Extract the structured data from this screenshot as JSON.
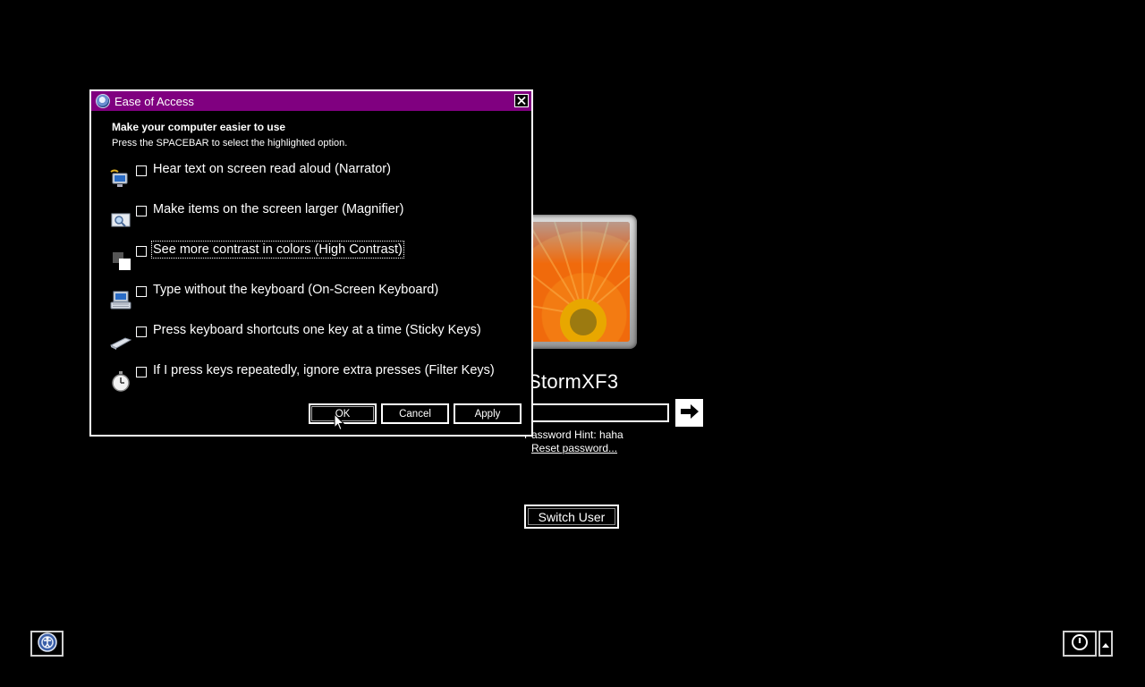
{
  "logon": {
    "user_name": "StormXF3",
    "password_placeholder": "",
    "password_hint": "Password Hint: haha",
    "reset_password": "Reset password...",
    "switch_user": "Switch User"
  },
  "dialog": {
    "title": "Ease of Access",
    "heading": "Make your computer easier to use",
    "instruction": "Press the SPACEBAR to select the highlighted option.",
    "options": [
      {
        "label": "Hear text on screen read aloud (Narrator)",
        "icon": "narrator-icon",
        "checked": false
      },
      {
        "label": "Make items on the screen larger (Magnifier)",
        "icon": "magnifier-icon",
        "checked": false
      },
      {
        "label": "See more contrast in colors (High Contrast)",
        "icon": "high-contrast-icon",
        "checked": false,
        "focused": true
      },
      {
        "label": "Type without the keyboard (On-Screen Keyboard)",
        "icon": "onscreen-keyboard-icon",
        "checked": false
      },
      {
        "label": "Press keyboard shortcuts one key at a time (Sticky Keys)",
        "icon": "sticky-keys-icon",
        "checked": false
      },
      {
        "label": "If I press keys repeatedly, ignore extra presses (Filter Keys)",
        "icon": "filter-keys-icon",
        "checked": false
      }
    ],
    "buttons": {
      "ok": "OK",
      "cancel": "Cancel",
      "apply": "Apply"
    }
  },
  "icons": {
    "ease_of_access": "ease-of-access-icon",
    "shutdown": "power-icon",
    "shutdown_menu": "arrow-up-icon",
    "submit": "arrow-right-icon"
  },
  "colors": {
    "background": "#000000",
    "titlebar": "#800080",
    "foreground": "#ffffff"
  }
}
